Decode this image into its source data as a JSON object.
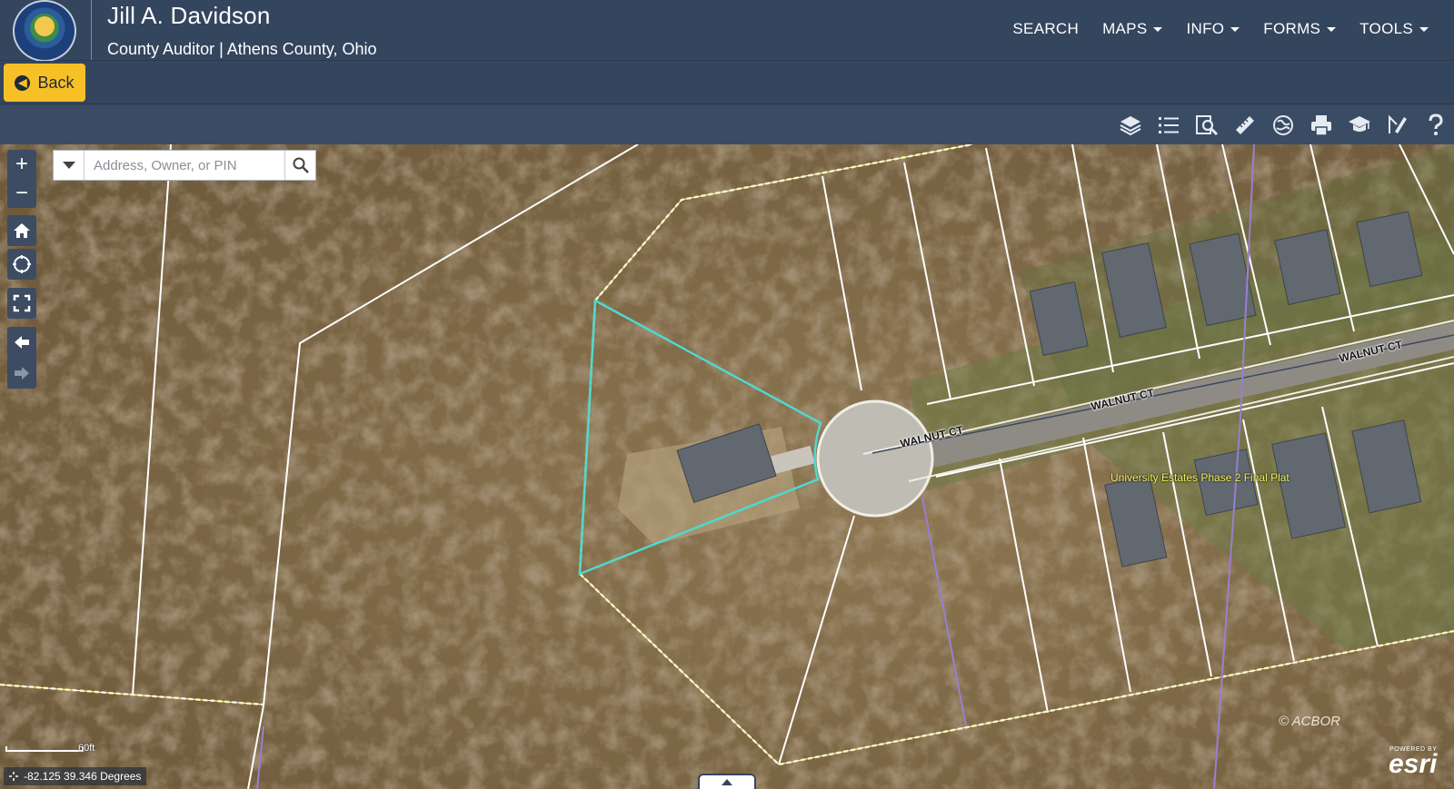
{
  "header": {
    "title": "Jill A. Davidson",
    "subtitle": "County Auditor | Athens County, Ohio",
    "nav": [
      {
        "label": "SEARCH",
        "dropdown": false
      },
      {
        "label": "MAPS",
        "dropdown": true
      },
      {
        "label": "INFO",
        "dropdown": true
      },
      {
        "label": "FORMS",
        "dropdown": true
      },
      {
        "label": "TOOLS",
        "dropdown": true
      }
    ]
  },
  "back": {
    "label": "Back"
  },
  "toolbar": {
    "tools": [
      "layers-icon",
      "legend-list-icon",
      "identify-search-icon",
      "measure-ruler-icon",
      "basemap-gallery-icon",
      "print-icon",
      "education-cap-icon",
      "draw-markup-icon",
      "help-icon"
    ]
  },
  "map": {
    "search": {
      "placeholder": "Address, Owner, or PIN"
    },
    "labels": {
      "street_1": "WALNUT CT",
      "street_2": "WALNUT CT",
      "street_3": "WALNUT CT",
      "plat": "University Estates Phase 2 Final Plat"
    },
    "coordinates": "-82.125 39.346 Degrees",
    "scale": "60ft",
    "copyright": "© ACBOR",
    "esri": {
      "small": "POWERED BY",
      "big": "esri"
    }
  },
  "colors": {
    "header_bg": "#34455e",
    "back_button": "#f6c026",
    "parcel_line": "#ffffff",
    "selected_parcel": "#4fd8d0",
    "plat_boundary": "#f2e87a",
    "plat_label": "#f2f25a",
    "water_line": "#9a7fd0"
  }
}
